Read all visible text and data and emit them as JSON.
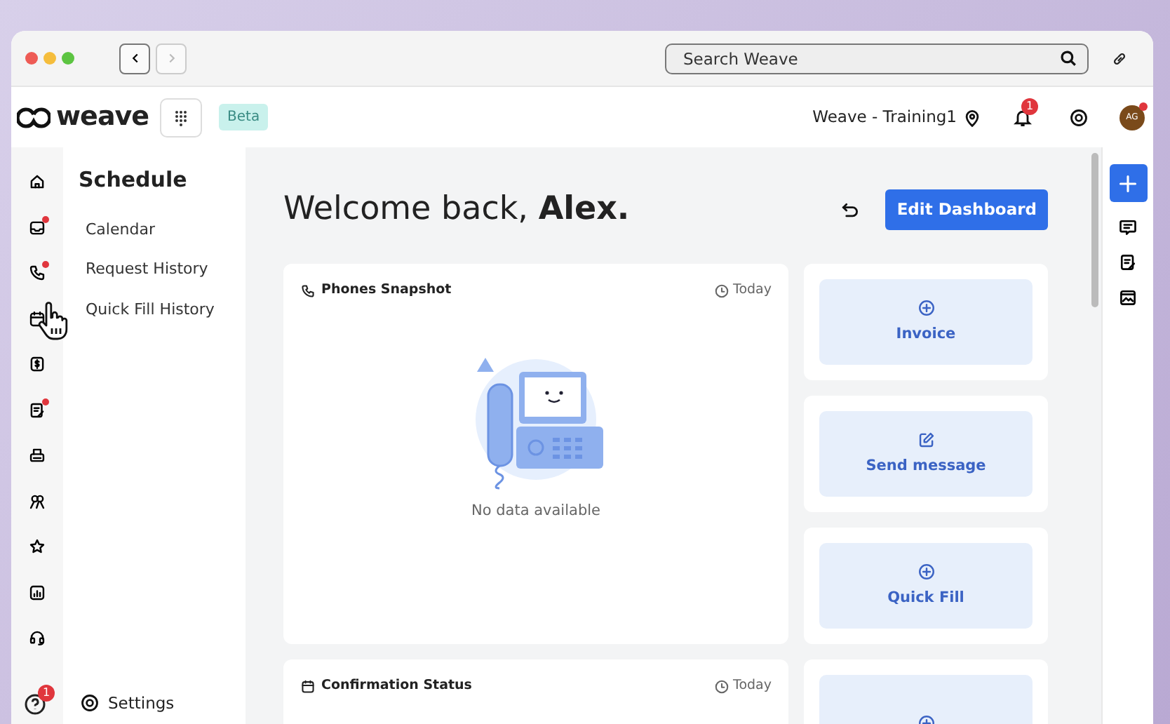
{
  "browser": {
    "nav_buttons": [
      {
        "disabled": false
      },
      {
        "disabled": true
      }
    ],
    "search": {
      "placeholder": "Search Weave"
    }
  },
  "header": {
    "logo": "weave",
    "beta": "Beta",
    "location": "Weave - Training1",
    "notifications_badge": "1",
    "avatar": "AG"
  },
  "rail": {
    "items": [
      {
        "kind": "home",
        "dot": false
      },
      {
        "kind": "inbox",
        "dot": true
      },
      {
        "kind": "phone",
        "dot": true
      },
      {
        "kind": "calendar",
        "dot": false
      },
      {
        "kind": "dollar",
        "dot": false
      },
      {
        "kind": "form",
        "dot": true
      },
      {
        "kind": "printer",
        "dot": false
      },
      {
        "kind": "people",
        "dot": false
      },
      {
        "kind": "star",
        "dot": false
      },
      {
        "kind": "chart",
        "dot": false
      },
      {
        "kind": "support",
        "dot": false
      }
    ],
    "help_badge": "1"
  },
  "sidebar": {
    "title": "Schedule",
    "items": [
      "Calendar",
      "Request History",
      "Quick Fill History"
    ],
    "settings": "Settings"
  },
  "main": {
    "greeting": "Welcome back, **Alex.**",
    "edit_button": "Edit Dashboard",
    "cards": [
      {
        "kind": "phone",
        "title": "Phones Snapshot",
        "period": "Today",
        "empty": "No data available"
      },
      {
        "kind": "calendar",
        "title": "Confirmation Status",
        "period": "Today"
      }
    ],
    "actions": [
      {
        "kind": "plus",
        "label": "Invoice"
      },
      {
        "kind": "edit",
        "label": "Send message"
      },
      {
        "kind": "plus",
        "label": "Quick Fill"
      },
      {
        "kind": "plus"
      }
    ]
  },
  "right_rail": [
    {
      "kind": "add"
    },
    {
      "kind": "message"
    },
    {
      "kind": "form"
    },
    {
      "kind": "image"
    }
  ]
}
